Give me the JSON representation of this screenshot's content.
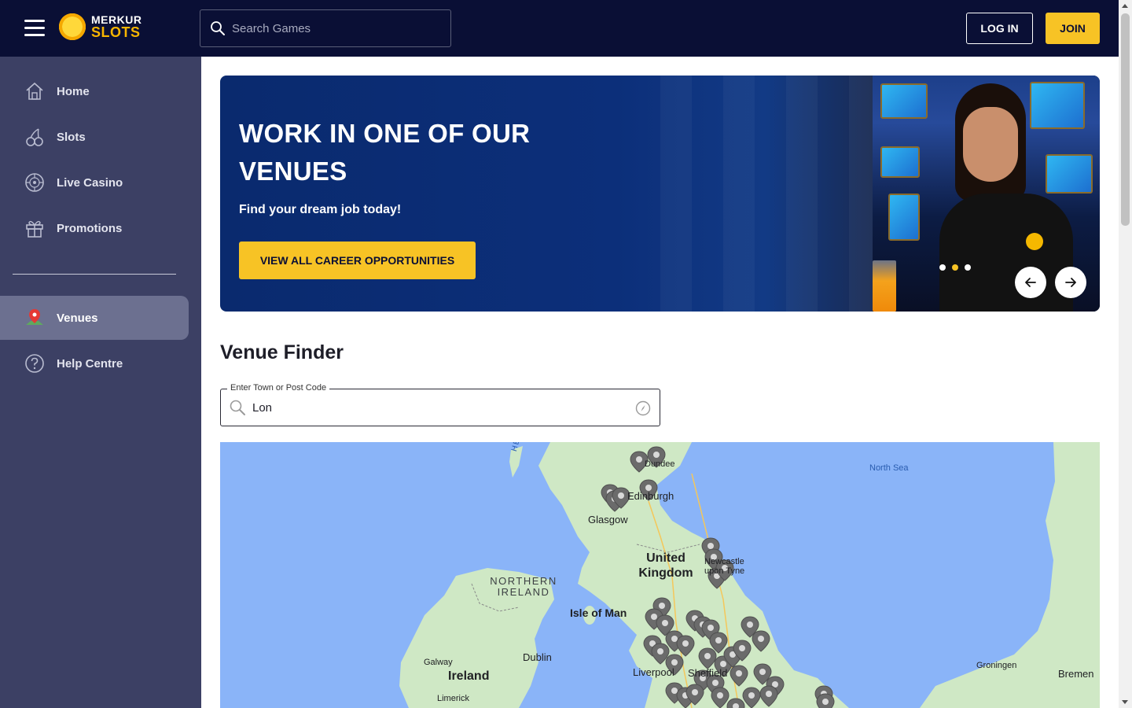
{
  "header": {
    "logo_top": "MERKUR",
    "logo_bottom": "SLOTS",
    "search_placeholder": "Search Games",
    "login_label": "LOG IN",
    "join_label": "JOIN"
  },
  "sidebar": {
    "items": [
      {
        "label": "Home",
        "icon": "home-icon"
      },
      {
        "label": "Slots",
        "icon": "cherries-icon"
      },
      {
        "label": "Live Casino",
        "icon": "roulette-icon"
      },
      {
        "label": "Promotions",
        "icon": "gift-icon"
      },
      {
        "label": "Venues",
        "icon": "map-pin-icon",
        "active": true
      },
      {
        "label": "Help Centre",
        "icon": "help-icon"
      }
    ]
  },
  "banner": {
    "title": "WORK IN ONE OF OUR VENUES",
    "subtitle": "Find your dream job today!",
    "cta_label": "VIEW ALL CAREER OPPORTUNITIES",
    "active_dot": 1
  },
  "venue_finder": {
    "title": "Venue Finder",
    "input_label": "Enter Town or Post Code",
    "input_value": "Lon"
  },
  "map": {
    "labels": {
      "north_sea": "North Sea",
      "uk": "United Kingdom",
      "northern_ireland": "NORTHERN IRELAND",
      "isle_of_man": "Isle of Man",
      "ireland": "Ireland",
      "glasgow": "Glasgow",
      "edinburgh": "Edinburgh",
      "dundee": "Dundee",
      "newcastle": "Newcastle upon Tyne",
      "dublin": "Dublin",
      "galway": "Galway",
      "limerick": "Limerick",
      "liverpool": "Liverpool",
      "sheffield": "Sheffield",
      "groningen": "Groningen",
      "bremen": "Bremen",
      "hebrides": "HEBRIDES"
    },
    "colors": {
      "water": "#8ab4f8",
      "land": "#cfe8c5",
      "marker": "#6b6b6b"
    }
  }
}
